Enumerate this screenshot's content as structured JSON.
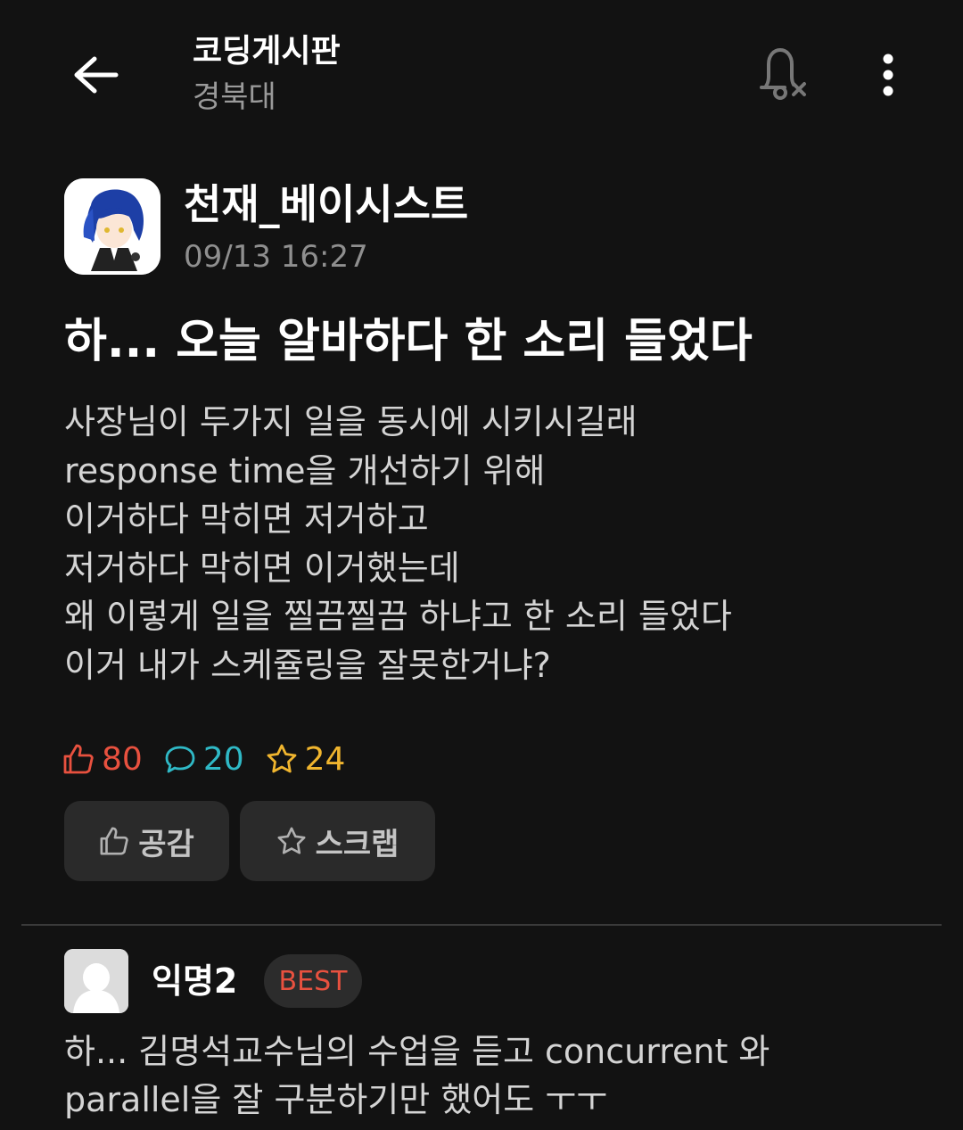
{
  "header": {
    "board_title": "코딩게시판",
    "board_subtitle": "경북대",
    "back_icon": "arrow-left-icon",
    "notification_icon": "bell-off-icon",
    "more_icon": "more-vertical-icon"
  },
  "post": {
    "author": {
      "name": "천재_베이시스트",
      "timestamp": "09/13 16:27"
    },
    "title": "하... 오늘 알바하다 한 소리 들었다",
    "body_lines": [
      "사장님이 두가지 일을 동시에 시키시길래",
      "response time을 개선하기 위해",
      "이거하다 막히면 저거하고",
      "저거하다 막히면 이거했는데",
      "왜 이렇게 일을 찔끔찔끔 하냐고 한 소리 들었다",
      "이거 내가 스케쥴링을 잘못한거냐?"
    ],
    "stats": {
      "likes": "80",
      "comments": "20",
      "scraps": "24"
    },
    "actions": {
      "like_label": "공감",
      "scrap_label": "스크랩"
    }
  },
  "comments": [
    {
      "author": "익명2",
      "badge": "BEST",
      "lines": [
        "하... 김명석교수님의 수업을 듣고 concurrent 와",
        "parallel을 잘 구분하기만 했어도 ㅜㅜ"
      ]
    }
  ],
  "colors": {
    "background": "#121212",
    "like": "#e8513f",
    "comment": "#2fb9c6",
    "scrap": "#f0b52e",
    "button_bg": "#2a2a2a"
  }
}
